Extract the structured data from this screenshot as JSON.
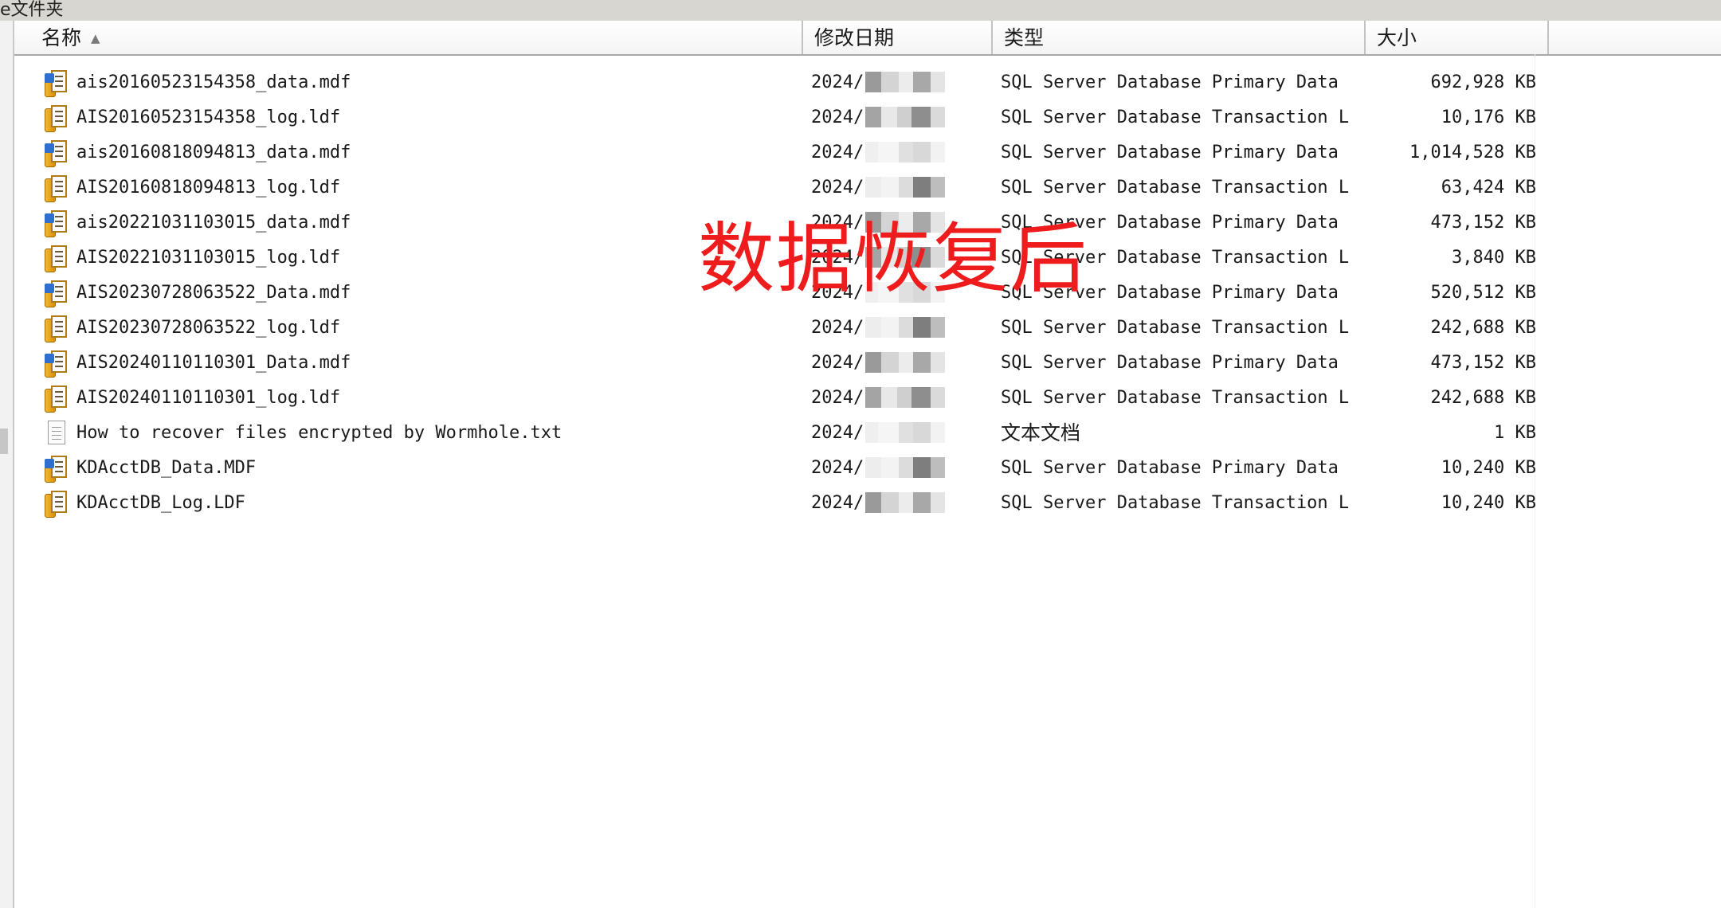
{
  "top_strip": {
    "crumb": "e文件夹"
  },
  "header": {
    "name": "名称",
    "sort_arrow": "▲",
    "date": "修改日期",
    "type": "类型",
    "size": "大小"
  },
  "files": [
    {
      "name": "ais20160523154358_data.mdf",
      "date": "2024/(",
      "type": "SQL Server Database Primary Data ...",
      "size": "692,928 KB",
      "icon": "sql-data-file-icon"
    },
    {
      "name": "AIS20160523154358_log.ldf",
      "date": "2024/(",
      "type": "SQL Server Database Transaction L...",
      "size": "10,176 KB",
      "icon": "sql-log-file-icon"
    },
    {
      "name": "ais20160818094813_data.mdf",
      "date": "2024/(",
      "type": "SQL Server Database Primary Data ...",
      "size": "1,014,528 KB",
      "icon": "sql-data-file-icon"
    },
    {
      "name": "AIS20160818094813_log.ldf",
      "date": "2024/(",
      "type": "SQL Server Database Transaction L...",
      "size": "63,424 KB",
      "icon": "sql-log-file-icon"
    },
    {
      "name": "ais20221031103015_data.mdf",
      "date": "2024/(",
      "type": "SQL Server Database Primary Data ...",
      "size": "473,152 KB",
      "icon": "sql-data-file-icon"
    },
    {
      "name": "AIS20221031103015_log.ldf",
      "date": "2024/(",
      "type": "SQL Server Database Transaction L...",
      "size": "3,840 KB",
      "icon": "sql-log-file-icon"
    },
    {
      "name": "AIS20230728063522_Data.mdf",
      "date": "2024/(",
      "type": "SQL Server Database Primary Data ...",
      "size": "520,512 KB",
      "icon": "sql-data-file-icon"
    },
    {
      "name": "AIS20230728063522_log.ldf",
      "date": "2024/(",
      "type": "SQL Server Database Transaction L...",
      "size": "242,688 KB",
      "icon": "sql-log-file-icon"
    },
    {
      "name": "AIS20240110110301_Data.mdf",
      "date": "2024/(",
      "type": "SQL Server Database Primary Data ...",
      "size": "473,152 KB",
      "icon": "sql-data-file-icon"
    },
    {
      "name": "AIS20240110110301_log.ldf",
      "date": "2024/(",
      "type": "SQL Server Database Transaction L...",
      "size": "242,688 KB",
      "icon": "sql-log-file-icon"
    },
    {
      "name": "How to recover files encrypted by Wormhole.txt",
      "date": "2024/(",
      "type": "文本文档",
      "size": "1 KB",
      "icon": "text-file-icon"
    },
    {
      "name": "KDAcctDB_Data.MDF",
      "date": "2024/(",
      "type": "SQL Server Database Primary Data ...",
      "size": "10,240 KB",
      "icon": "sql-data-file-icon"
    },
    {
      "name": "KDAcctDB_Log.LDF",
      "date": "2024/(",
      "type": "SQL Server Database Transaction L...",
      "size": "10,240 KB",
      "icon": "sql-log-file-icon"
    }
  ],
  "overlay": {
    "text": "数据恢复后",
    "color": "#ee1c1c"
  }
}
